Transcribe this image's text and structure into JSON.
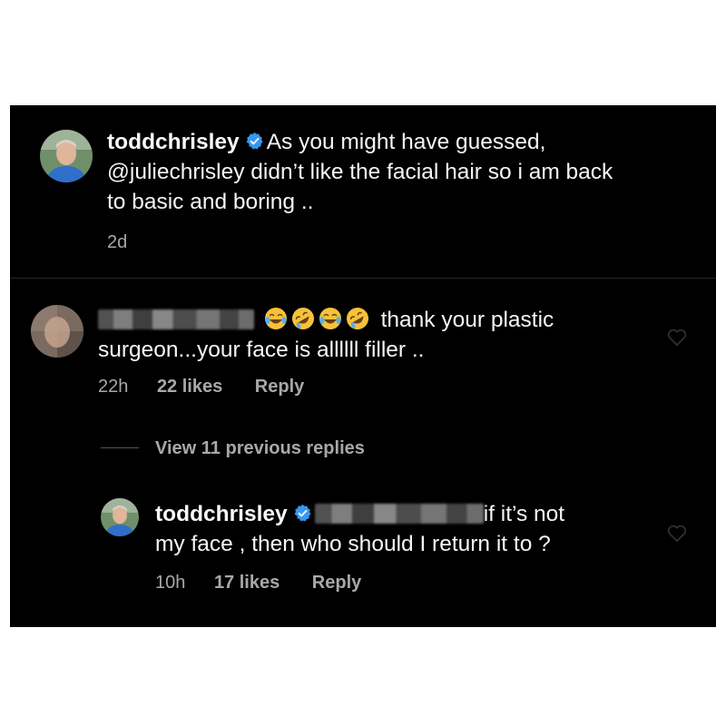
{
  "post": {
    "author": "toddchrisley",
    "caption_lines": [
      "As you might have guessed,",
      "@juliechrisley didn’t like the facial hair so i am back",
      "to basic and boring .."
    ],
    "time": "2d",
    "verified_icon": "verified-badge-icon"
  },
  "comment": {
    "author_redacted": true,
    "text_line1": "thank your plastic",
    "text_line2": "surgeon...your face is allllll filler ..",
    "time": "22h",
    "likes": "22 likes",
    "reply_label": "Reply",
    "emojis": [
      "face-with-tears-of-joy-icon",
      "rolling-on-floor-laughing-icon",
      "face-with-tears-of-joy-icon",
      "rolling-on-floor-laughing-icon"
    ]
  },
  "view_replies_label": "View 11 previous replies",
  "reply": {
    "author": "toddchrisley",
    "text_line1": "if it’s not",
    "text_line2": "my face , then who should I return it to ?",
    "time": "10h",
    "likes": "17 likes",
    "reply_label": "Reply"
  },
  "colors": {
    "background": "#000000",
    "text": "#f5f5f5",
    "muted": "#a8a8a8",
    "verified": "#3797f0"
  }
}
